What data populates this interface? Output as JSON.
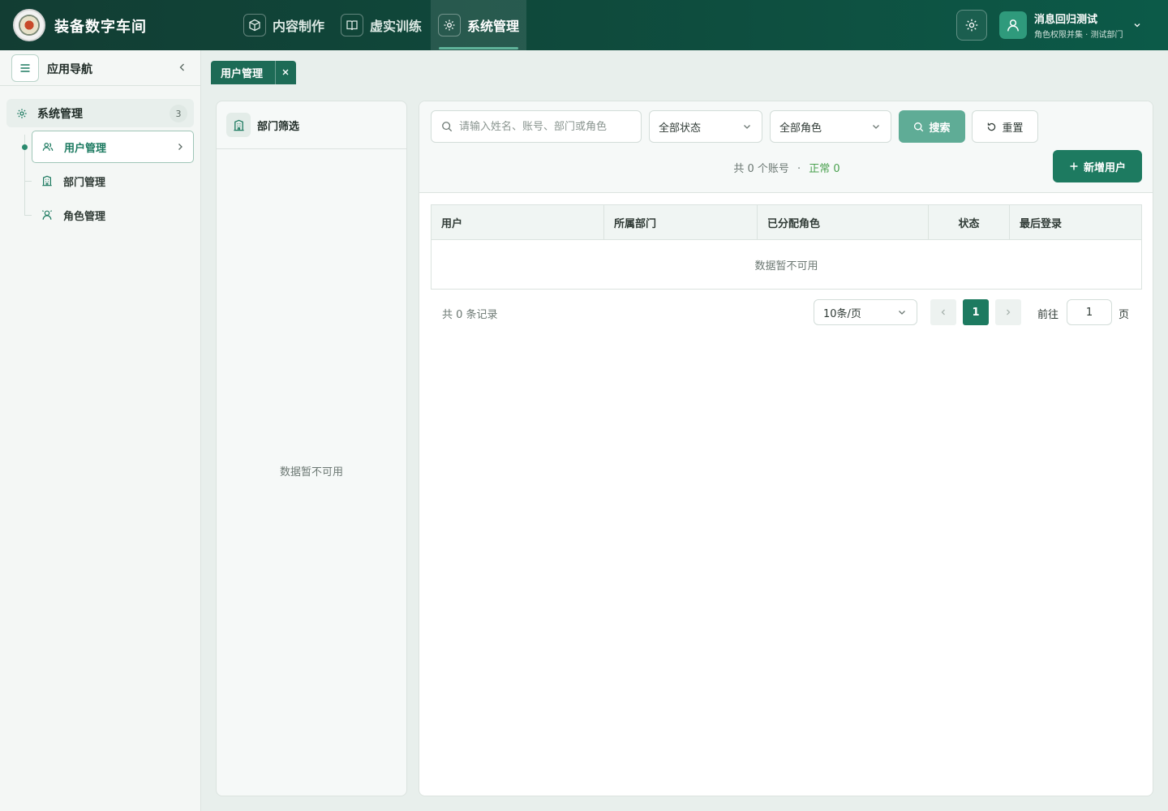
{
  "header": {
    "app_title": "装备数字车间",
    "nav": [
      {
        "label": "内容制作",
        "icon": "cube-icon"
      },
      {
        "label": "虚实训练",
        "icon": "book-icon"
      },
      {
        "label": "系统管理",
        "icon": "gear-icon",
        "active": true
      }
    ],
    "user": {
      "name": "消息回归测试",
      "subtitle": "角色权限并集 · 测试部门"
    }
  },
  "sidebar": {
    "title": "应用导航",
    "group": {
      "label": "系统管理",
      "count": "3"
    },
    "items": [
      {
        "label": "用户管理",
        "icon": "users-icon",
        "active": true
      },
      {
        "label": "部门管理",
        "icon": "building-icon"
      },
      {
        "label": "角色管理",
        "icon": "role-icon"
      }
    ]
  },
  "tabs": [
    {
      "label": "用户管理"
    }
  ],
  "dept_panel": {
    "title": "部门筛选",
    "empty_text": "数据暂不可用"
  },
  "filters": {
    "search_placeholder": "请输入姓名、账号、部门或角色",
    "status_select": "全部状态",
    "role_select": "全部角色",
    "search_label": "搜索",
    "reset_label": "重置",
    "add_label": "新增用户"
  },
  "summary": {
    "total_text": "共 0 个账号",
    "separator": "·",
    "normal_text": "正常 0"
  },
  "table": {
    "columns": [
      "用户",
      "所属部门",
      "已分配角色",
      "状态",
      "最后登录"
    ],
    "empty_text": "数据暂不可用"
  },
  "pagination": {
    "total_text": "共 0 条记录",
    "page_size": "10条/页",
    "current_page": "1",
    "goto_label": "前往",
    "goto_value": "1",
    "page_suffix": "页"
  },
  "colors": {
    "brand_dark": "#123d33",
    "accent": "#1d7a60",
    "success": "#4aa14f"
  }
}
